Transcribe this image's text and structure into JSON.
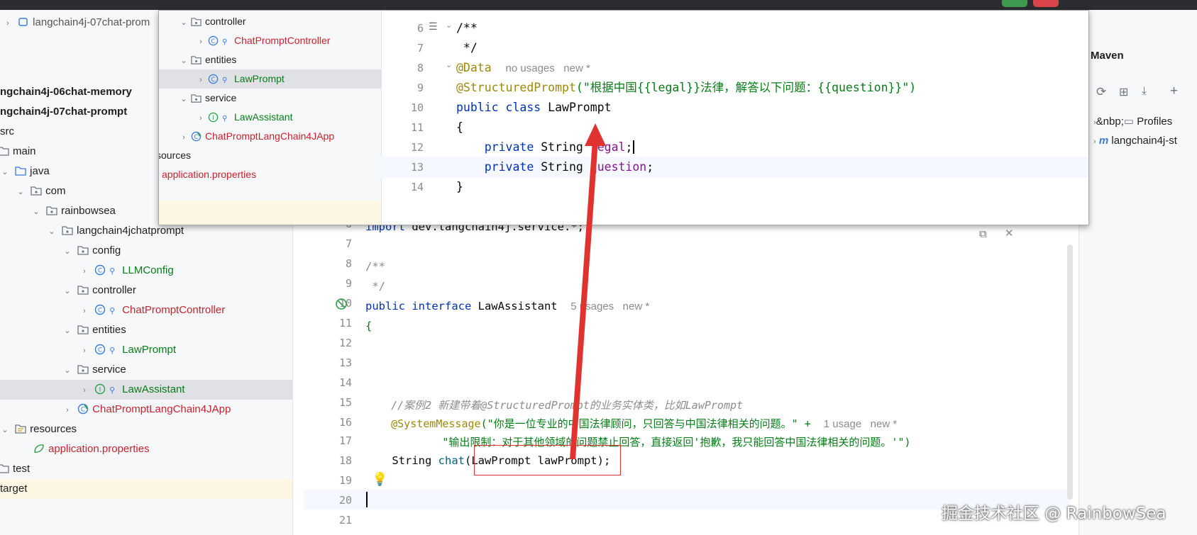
{
  "tree": {
    "breadcrumb": "langchain4j-07chat-prom",
    "modules": [
      "ngchain4j-06chat-memory",
      "ngchain4j-07chat-prompt"
    ],
    "items": {
      "src": "src",
      "main": "main",
      "java": "java",
      "com": "com",
      "rainbowsea": "rainbowsea",
      "pkg": "langchain4jchatprompt",
      "config": "config",
      "llmconfig": "LLMConfig",
      "controller": "controller",
      "chatpromptcontroller": "ChatPromptController",
      "entities": "entities",
      "lawprompt": "LawPrompt",
      "service": "service",
      "lawassistant": "LawAssistant",
      "app": "ChatPromptLangChain4JApp",
      "resources": "resources",
      "appprops": "application.properties",
      "test": "test",
      "target": "target"
    }
  },
  "popup_tree": {
    "controller": "controller",
    "chatpromptcontroller": "ChatPromptController",
    "entities": "entities",
    "lawprompt": "LawPrompt",
    "service": "service",
    "lawassistant": "LawAssistant",
    "app": "ChatPromptLangChain4JApp",
    "resources": "sources",
    "appprops": "application.properties"
  },
  "popup_code": {
    "lines": [
      "6",
      "7",
      "8",
      "9",
      "10",
      "11",
      "12",
      "13",
      "14"
    ],
    "l6": "/**",
    "l7": " */",
    "l8_ann": "@Data",
    "l8_hint": "no usages   new *",
    "l9_ann": "@StructuredPrompt",
    "l9_str": "(\"根据中国{{legal}}法律，解答以下问题：{{question}}\")",
    "l10_kw": "public class ",
    "l10_name": "LawPrompt",
    "l11": "{",
    "l12_kw": "    private ",
    "l12_type": "String ",
    "l12_fld": "legal",
    "l12_end": ";",
    "l13_kw": "    private ",
    "l13_type": "String ",
    "l13_fld": "question",
    "l13_end": ";",
    "l14": "}"
  },
  "editor": {
    "lines": [
      "6",
      "7",
      "8",
      "9",
      "10",
      "11",
      "12",
      "13",
      "14",
      "15",
      "16",
      "17",
      "18",
      "19",
      "20",
      "21"
    ],
    "l6_kw": "import ",
    "l6_rest": "dev.langchain4j.service.*;",
    "l8": "/**",
    "l9": " */",
    "l10_kw": "public interface ",
    "l10_name": "LawAssistant",
    "l10_hint": "5 usages   new *",
    "l11": "{",
    "l15": "    //案例2 新建带着@StructuredPrompt的业务实体类，比如LawPrompt",
    "l16_ann": "    @SystemMessage",
    "l16_str": "(\"你是一位专业的中国法律顾问，只回答与中国法律相关的问题。\" + ",
    "l16_hint": "1 usage   new *",
    "l17_str": "            \"输出限制：对于其他领域的问题禁止回答，直接返回'抱歉，我只能回答中国法律相关的问题。'\")",
    "l18_type": "    String ",
    "l18_meth": "chat",
    "l18_rest": "(LawPrompt lawPrompt);"
  },
  "maven": {
    "title": "Maven",
    "profiles": "Profiles",
    "project": "langchain4j-st"
  },
  "watermark": "掘金技术社区 @ RainbowSea",
  "colors": {
    "keyword": "#0033b3",
    "annotation": "#9e880d",
    "string": "#067d17",
    "field": "#871094",
    "red_file": "#c7222d",
    "arrow": "#e0332f"
  }
}
